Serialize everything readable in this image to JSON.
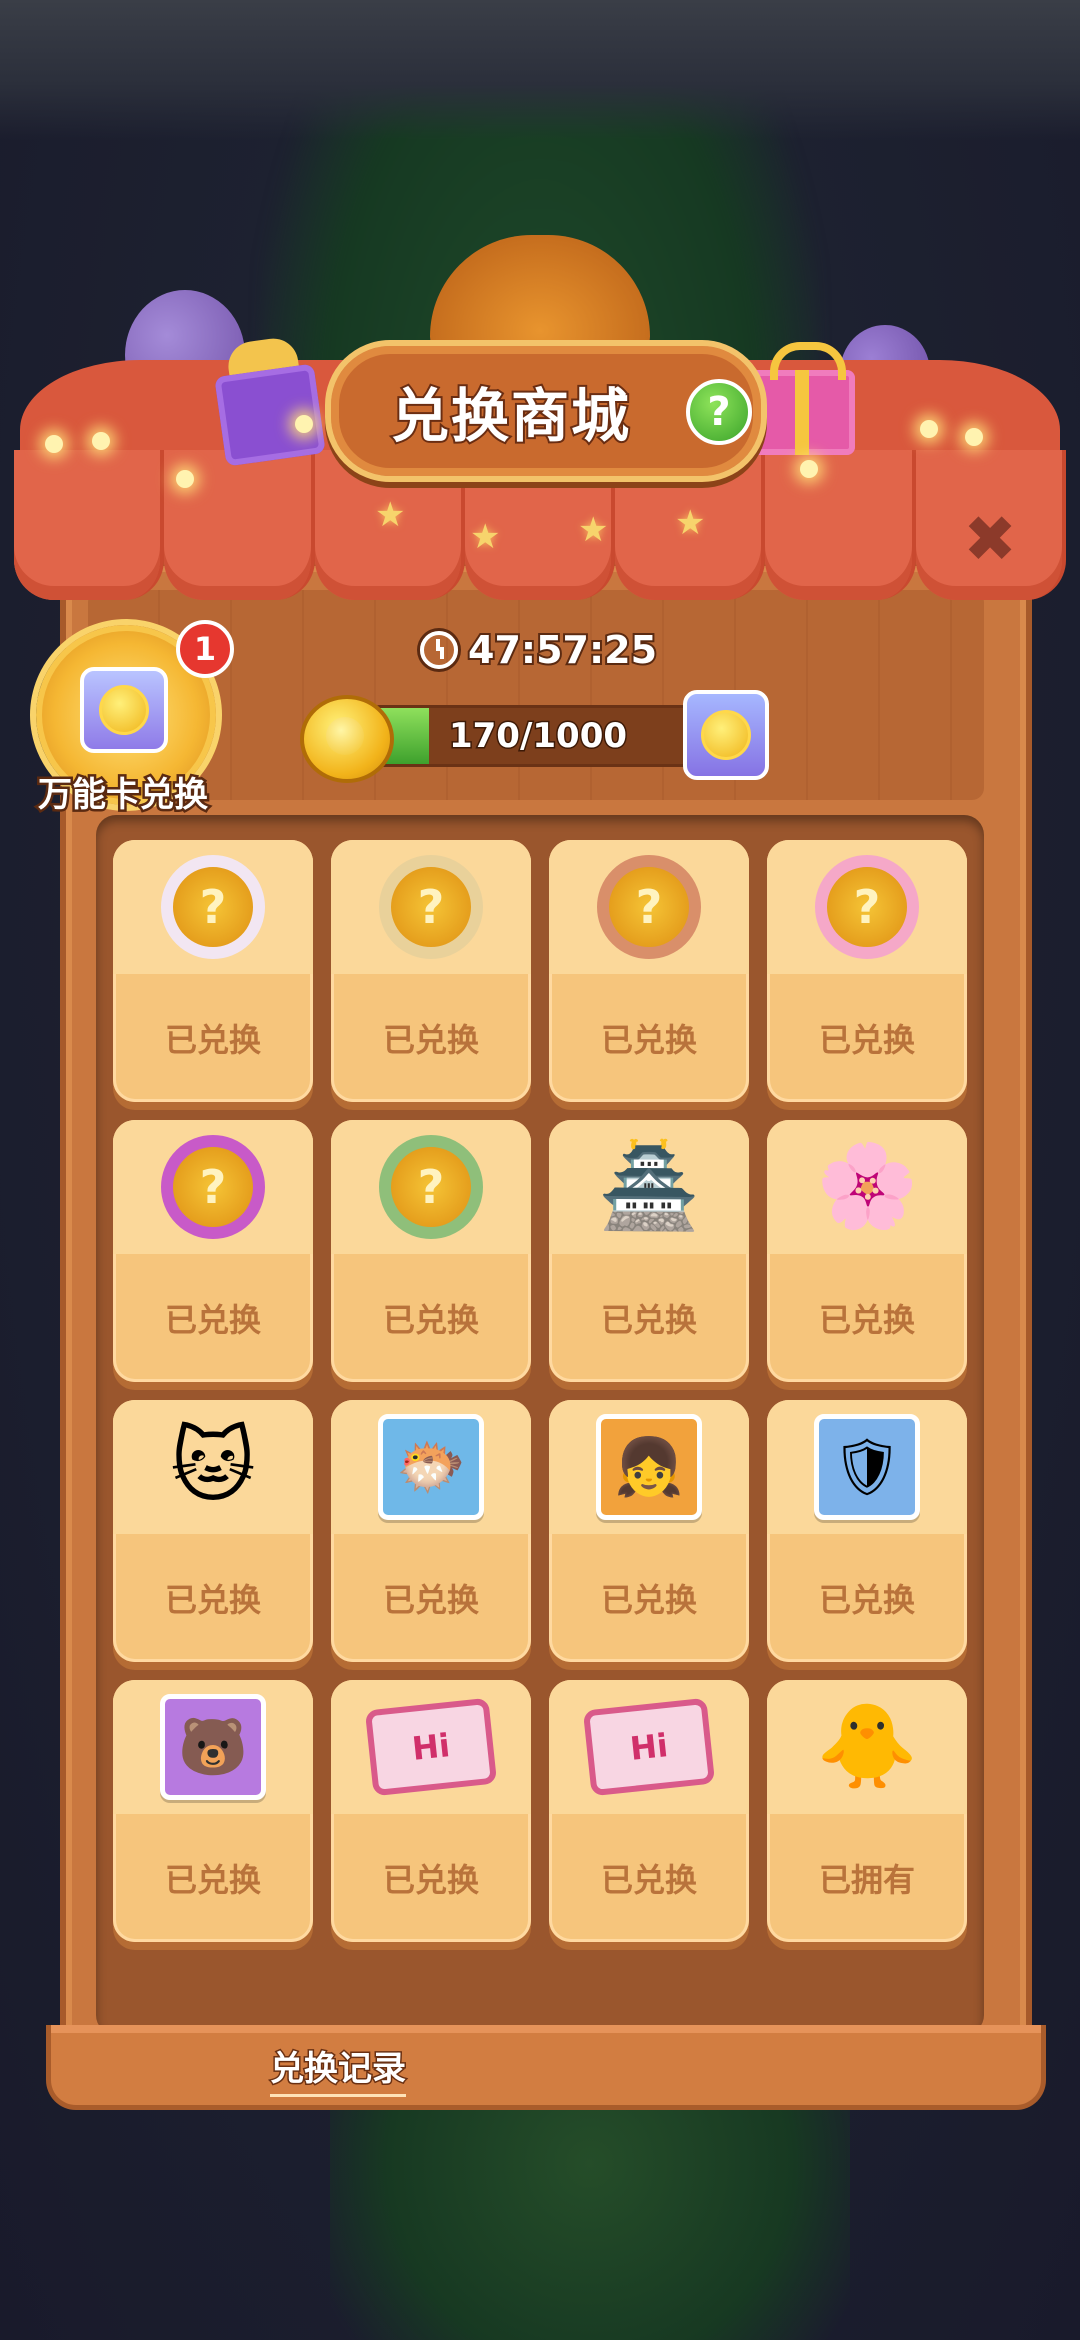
{
  "title": "兑换商城",
  "help_label": "?",
  "close_label": "✖",
  "universal_card": {
    "label": "万能卡兑换",
    "notification_count": "1"
  },
  "timer": {
    "value": "47:57:25"
  },
  "progress": {
    "text": "170/1000",
    "current": 170,
    "max": 1000
  },
  "items": [
    {
      "name": "cow-frame",
      "status": "已兑换",
      "kind": "frame",
      "ring": "#f2e6f2",
      "mark": "?"
    },
    {
      "name": "chef-bear-frame",
      "status": "已兑换",
      "kind": "frame",
      "ring": "#e9d19a",
      "mark": "?"
    },
    {
      "name": "floral-frame",
      "status": "已兑换",
      "kind": "frame",
      "ring": "#d98f6a",
      "mark": "?"
    },
    {
      "name": "candy-shop-frame",
      "status": "已兑换",
      "kind": "frame",
      "ring": "#f5a8c8",
      "mark": "?"
    },
    {
      "name": "rainbow-frame",
      "status": "已兑换",
      "kind": "frame",
      "ring": "#c85ac8",
      "mark": "?"
    },
    {
      "name": "flower-wreath-frame",
      "status": "已兑换",
      "kind": "frame",
      "ring": "#8fbf7a",
      "mark": "?"
    },
    {
      "name": "pagoda-ornament",
      "status": "已兑换",
      "kind": "emoji",
      "icon": "🏯"
    },
    {
      "name": "flower-charm",
      "status": "已兑换",
      "kind": "emoji",
      "icon": "🌸"
    },
    {
      "name": "lucky-cat",
      "status": "已兑换",
      "kind": "emoji",
      "icon": "🐱"
    },
    {
      "name": "pufferfish-avatar",
      "status": "已兑换",
      "kind": "avatar",
      "icon": "🐡",
      "bg": "#6fb8e8"
    },
    {
      "name": "girl-avatar",
      "status": "已兑换",
      "kind": "avatar",
      "icon": "👧",
      "bg": "#f2a23c"
    },
    {
      "name": "knight-avatar",
      "status": "已兑换",
      "kind": "avatar",
      "icon": "🛡",
      "bg": "#7db2ea"
    },
    {
      "name": "bear-avatar",
      "status": "已兑换",
      "kind": "avatar",
      "icon": "🐻",
      "bg": "#b77ae0"
    },
    {
      "name": "hi-card-floral",
      "status": "已兑换",
      "kind": "hi",
      "text": "Hi"
    },
    {
      "name": "hi-card-stars",
      "status": "已兑换",
      "kind": "hi",
      "text": "Hi"
    },
    {
      "name": "chick-sprout",
      "status": "已拥有",
      "kind": "emoji",
      "icon": "🐥"
    }
  ],
  "bottom": {
    "record_label": "兑换记录"
  }
}
